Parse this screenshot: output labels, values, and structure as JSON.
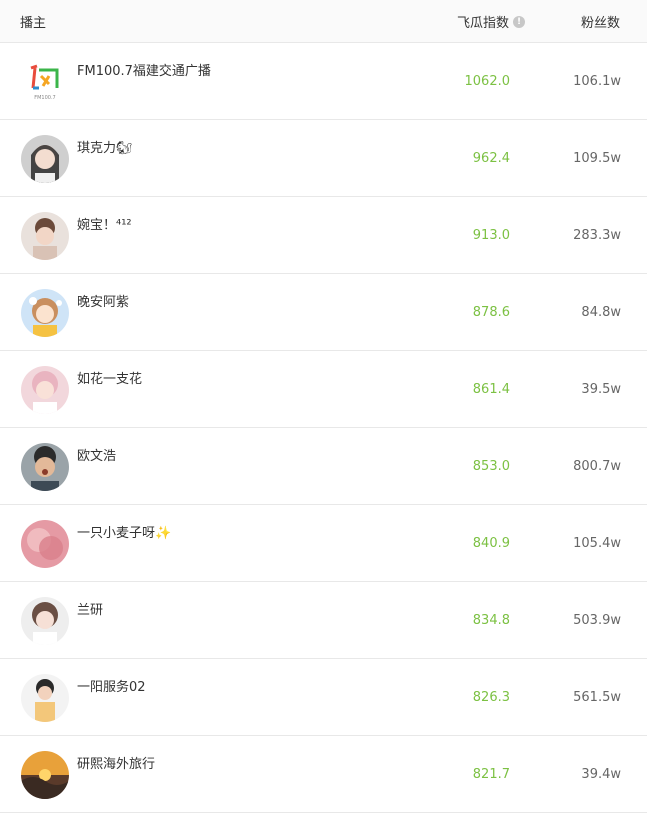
{
  "header": {
    "host_label": "播主",
    "index_label": "飞瓜指数",
    "fans_label": "粉丝数"
  },
  "rows": [
    {
      "name": "FM100.7福建交通广播",
      "index": "1062.0",
      "fans": "106.1w",
      "logo_text": "FM100.7"
    },
    {
      "name": "琪克力🐿",
      "index": "962.4",
      "fans": "109.5w"
    },
    {
      "name": "婉宝！⁴¹²",
      "index": "913.0",
      "fans": "283.3w"
    },
    {
      "name": "晚安阿紫",
      "index": "878.6",
      "fans": "84.8w"
    },
    {
      "name": "如花一支花",
      "index": "861.4",
      "fans": "39.5w"
    },
    {
      "name": "欧文浩",
      "index": "853.0",
      "fans": "800.7w"
    },
    {
      "name": "一只小麦子呀✨",
      "index": "840.9",
      "fans": "105.4w"
    },
    {
      "name": "兰研",
      "index": "834.8",
      "fans": "503.9w"
    },
    {
      "name": "一阳服务02",
      "index": "826.3",
      "fans": "561.5w"
    },
    {
      "name": "研熙海外旅行",
      "index": "821.7",
      "fans": "39.4w"
    }
  ]
}
